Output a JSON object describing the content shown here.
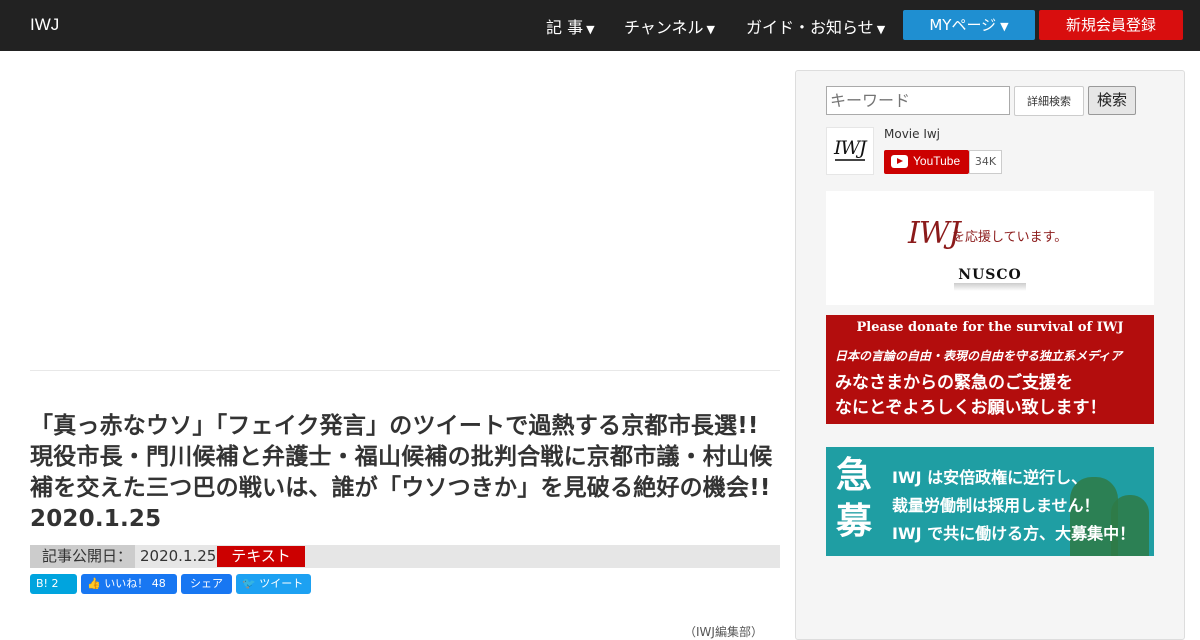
{
  "nav": {
    "brand": "IWJ",
    "items": [
      "記 事",
      "チャンネル",
      "ガイド・お知らせ"
    ],
    "mypage": "MYページ",
    "register": "新規会員登録"
  },
  "article": {
    "title": "「真っ赤なウソ」「フェイク発言」のツイートで過熱する京都市長選!! 現役市長・門川候補と弁護士・福山候補の批判合戦に京都市議・村山候補を交えた三つ巴の戦いは、誰が「ウソつきか」を見破る絶好の機会!! 2020.1.25",
    "published_label": "記事公開日：",
    "published_date": "2020.1.25",
    "tag": "テキスト",
    "byline": "（IWJ編集部）"
  },
  "share": {
    "hatena": "B! 2",
    "like": "いいね！ 48",
    "facebook": "シェア",
    "tweet": "ツイート"
  },
  "sidebar": {
    "search_placeholder": "キーワード",
    "detail_search": "詳細検索",
    "search": "検索",
    "channel_name": "Movie Iwj",
    "youtube_label": "YouTube",
    "subscriber_count": "34K",
    "nusco": {
      "logo": "IWJ",
      "support_text": "を応援しています。",
      "sponsor": "NUSCO"
    },
    "donate": {
      "line1": "Please donate for the survival of IWJ",
      "line2": "日本の言論の自由・表現の自由を守る独立系メディア",
      "line3": "みなさまからの緊急のご支援を",
      "line4": "なにとぞよろしくお願い致します！"
    },
    "recruit": {
      "big": "急募",
      "line1": "IWJ は安倍政権に逆行し、",
      "line2": "裁量労働制は採用しません！",
      "line3": "IWJ で共に働ける方、大募集中！"
    }
  }
}
